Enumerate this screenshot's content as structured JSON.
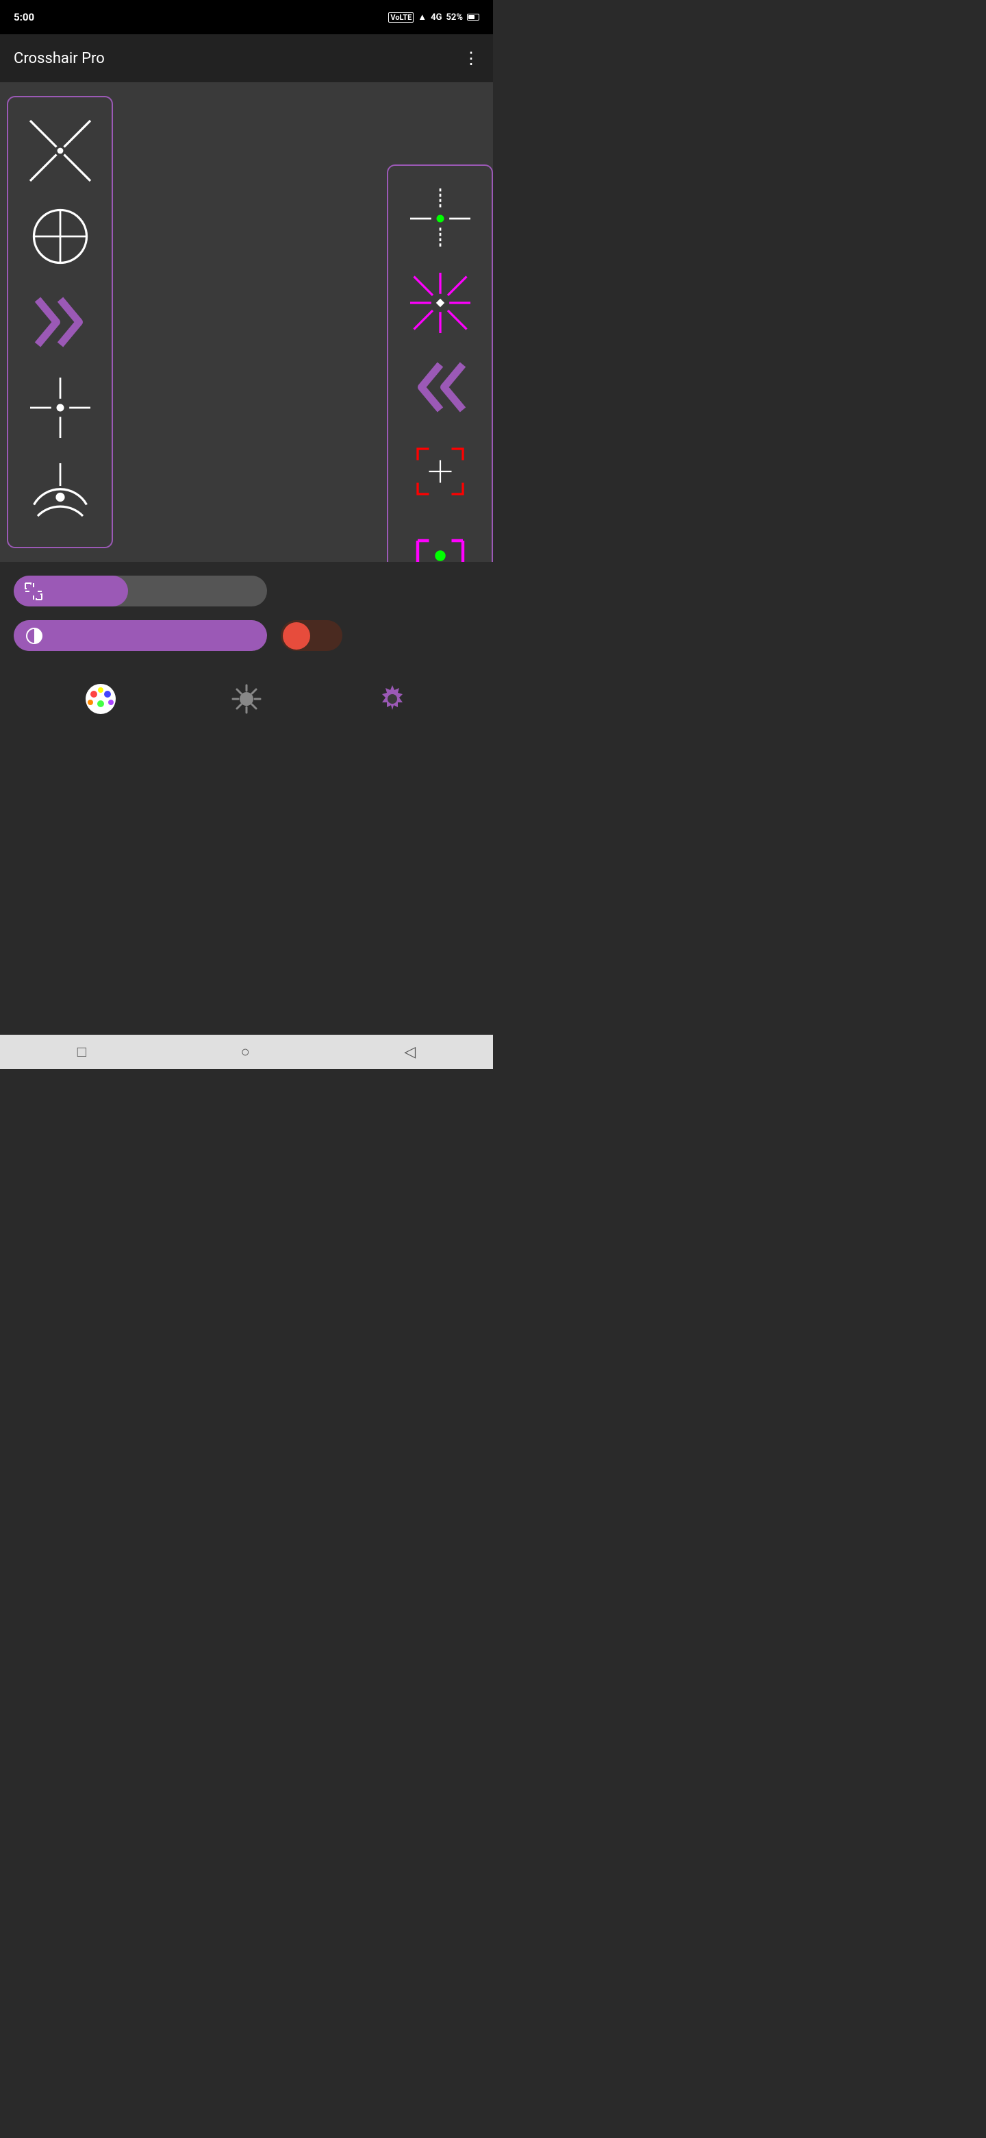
{
  "statusBar": {
    "time": "5:00",
    "battery": "52%",
    "signal": "4G"
  },
  "header": {
    "title": "Crosshair Pro",
    "menuIcon": "⋮"
  },
  "leftPanel": {
    "items": [
      {
        "id": "cross-x",
        "type": "x-cross"
      },
      {
        "id": "circle-cross",
        "type": "circle-cross"
      },
      {
        "id": "chevrons",
        "type": "chevrons-right"
      },
      {
        "id": "dot-cross",
        "type": "dot-cross"
      },
      {
        "id": "arc-dot",
        "type": "arc-dot"
      }
    ]
  },
  "rightPanel": {
    "items": [
      {
        "id": "dashed-cross",
        "type": "dashed-cross"
      },
      {
        "id": "star-cross",
        "type": "star-cross"
      },
      {
        "id": "chevrons-left",
        "type": "chevrons-left"
      },
      {
        "id": "bracket-cross",
        "type": "bracket-cross"
      },
      {
        "id": "bracket-dot",
        "type": "bracket-dot"
      }
    ]
  },
  "controls": {
    "sizeSliderLabel": "size",
    "opacitySliderLabel": "opacity",
    "toggleLabel": "toggle"
  },
  "toolbar": {
    "paletteLabel": "palette",
    "brightnessLabel": "brightness",
    "settingsLabel": "settings"
  },
  "nav": {
    "squareLabel": "□",
    "circleLabel": "○",
    "backLabel": "◁"
  }
}
